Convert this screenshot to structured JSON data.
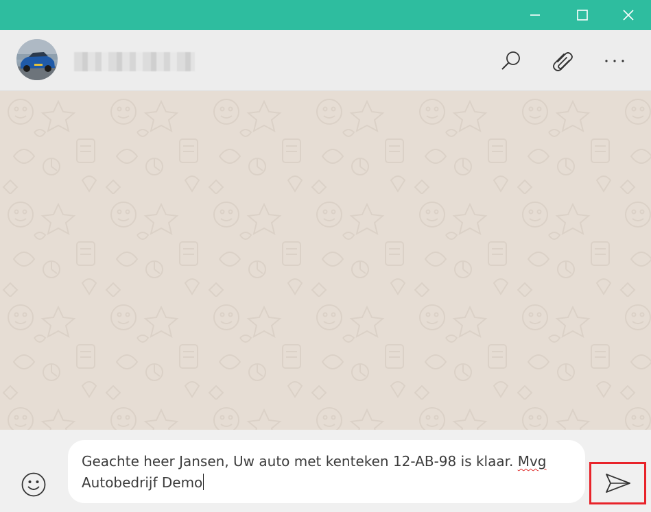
{
  "window": {
    "title_bar_color": "#2ebd9f",
    "controls": {
      "minimize_icon": "minimize-icon",
      "maximize_icon": "maximize-icon",
      "close_icon": "close-icon"
    }
  },
  "header": {
    "avatar_icon": "contact-avatar",
    "contact_name": "",
    "actions": {
      "search_icon": "search-icon",
      "attach_icon": "paperclip-icon",
      "more_icon": "more-options-icon"
    }
  },
  "chat": {
    "background_color": "#e6ddd4"
  },
  "composer": {
    "message_part1": "Geachte heer Jansen, Uw auto met kenteken 12-AB-98 is klaar. ",
    "message_misspelled": "Mvg",
    "message_part2": "Autobedrijf Demo",
    "emoji_icon": "emoji-icon",
    "send_icon": "send-icon",
    "send_highlight_color": "#e8232a"
  }
}
